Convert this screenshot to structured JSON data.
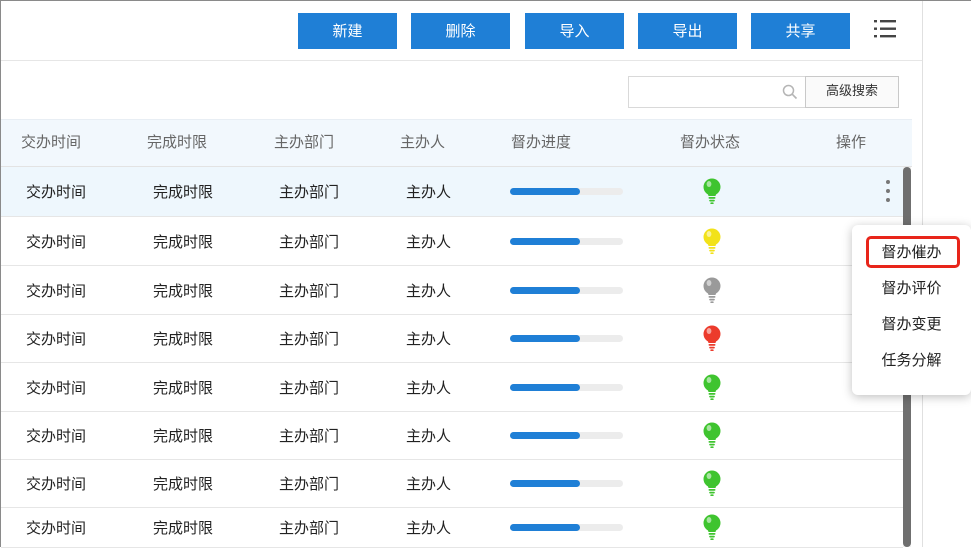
{
  "toolbar": {
    "buttons": [
      "新建",
      "删除",
      "导入",
      "导出",
      "共享"
    ],
    "accent_color": "#1f7fd6",
    "menu_icon": "list-menu-icon"
  },
  "search": {
    "value": "",
    "placeholder": "",
    "advanced_label": "高级搜索"
  },
  "table": {
    "headers": [
      "交办时间",
      "完成时限",
      "主办部门",
      "主办人",
      "督办进度",
      "督办状态",
      "操作"
    ],
    "rows": [
      {
        "time": "交办时间",
        "deadline": "完成时限",
        "dept": "主办部门",
        "owner": "主办人",
        "progress": 0.62,
        "status": "green",
        "selected": true
      },
      {
        "time": "交办时间",
        "deadline": "完成时限",
        "dept": "主办部门",
        "owner": "主办人",
        "progress": 0.62,
        "status": "yellow"
      },
      {
        "time": "交办时间",
        "deadline": "完成时限",
        "dept": "主办部门",
        "owner": "主办人",
        "progress": 0.62,
        "status": "gray"
      },
      {
        "time": "交办时间",
        "deadline": "完成时限",
        "dept": "主办部门",
        "owner": "主办人",
        "progress": 0.62,
        "status": "red"
      },
      {
        "time": "交办时间",
        "deadline": "完成时限",
        "dept": "主办部门",
        "owner": "主办人",
        "progress": 0.62,
        "status": "green"
      },
      {
        "time": "交办时间",
        "deadline": "完成时限",
        "dept": "主办部门",
        "owner": "主办人",
        "progress": 0.62,
        "status": "green"
      },
      {
        "time": "交办时间",
        "deadline": "完成时限",
        "dept": "主办部门",
        "owner": "主办人",
        "progress": 0.62,
        "status": "green"
      },
      {
        "time": "交办时间",
        "deadline": "完成时限",
        "dept": "主办部门",
        "owner": "主办人",
        "progress": 0.62,
        "status": "green"
      }
    ]
  },
  "status_colors": {
    "green": "#3fc42f",
    "yellow": "#f2e21a",
    "gray": "#9a9a9a",
    "red": "#ec3b2c"
  },
  "action_menu": {
    "items": [
      "督办催办",
      "督办评价",
      "督办变更",
      "任务分解"
    ],
    "highlight_color": "#e8251a"
  }
}
